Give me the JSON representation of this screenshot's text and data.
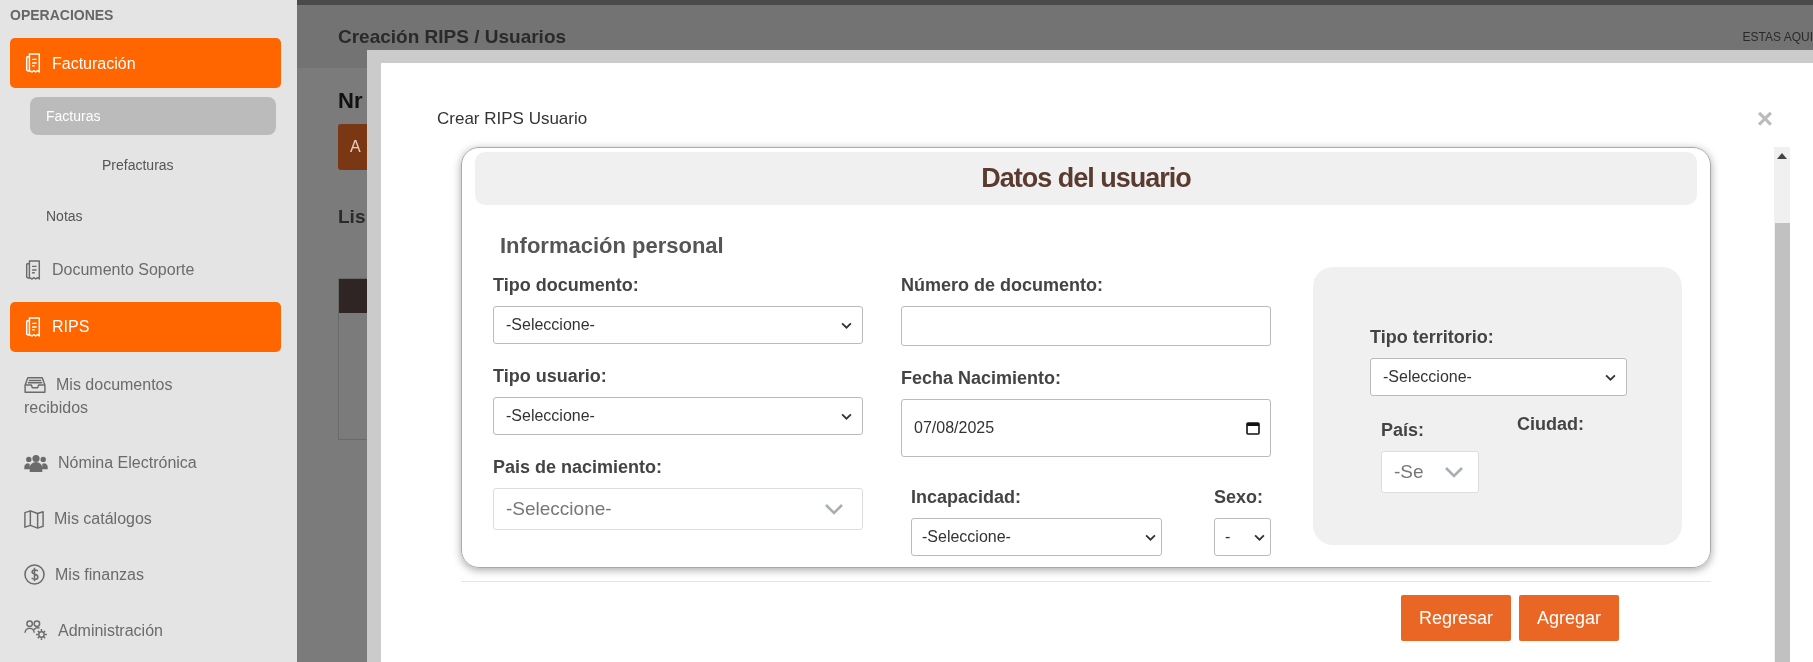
{
  "sidebar": {
    "section": "OPERACIONES",
    "items": [
      {
        "label": "Facturación",
        "selected": true,
        "children": [
          {
            "label": "Facturas",
            "selected": true,
            "children": [
              {
                "label": "Prefacturas",
                "selected": false
              }
            ]
          },
          {
            "label": "Notas",
            "selected": false
          }
        ]
      },
      {
        "label": "Documento Soporte",
        "selected": false
      },
      {
        "label": "RIPS",
        "selected": true
      },
      {
        "label": "Mis documentos recibidos",
        "selected": false
      },
      {
        "label": "Nómina Electrónica",
        "selected": false
      },
      {
        "label": "Mis catálogos",
        "selected": false
      },
      {
        "label": "Mis finanzas",
        "selected": false
      },
      {
        "label": "Administración",
        "selected": false
      }
    ]
  },
  "header": {
    "breadcrumb": "Creación RIPS / Usuarios",
    "location_label": "ESTAS AQUI"
  },
  "page": {
    "title": "Nr",
    "button": "A",
    "section_title": "Lis"
  },
  "modal": {
    "title": "Crear RIPS Usuario",
    "close": "×",
    "card_title": "Datos del usuario",
    "subtitle": "Información personal",
    "columns": [
      [
        {
          "kind": "select",
          "label": "Tipo documento:",
          "value": "-Seleccione-"
        },
        {
          "kind": "select",
          "label": "Tipo usuario:",
          "value": "-Seleccione-"
        },
        {
          "kind": "select2",
          "label": "Pais de nacimiento:",
          "value": "-Seleccione-"
        }
      ],
      [
        {
          "kind": "text",
          "label": "Número de documento:"
        },
        {
          "kind": "date",
          "label": "Fecha Nacimiento:",
          "value": "07/08/2025"
        },
        {
          "kind": "row",
          "fields": [
            {
              "kind": "select",
              "label": "Incapacidad:",
              "value": "-Seleccione-"
            },
            {
              "kind": "select",
              "label": "Sexo:",
              "value": "-"
            }
          ]
        }
      ]
    ],
    "panel": [
      {
        "kind": "select",
        "label": "Tipo territorio:",
        "value": "-Seleccione-"
      },
      {
        "kind": "row",
        "fields": [
          {
            "kind": "select2",
            "label": "País:",
            "value": "-Se"
          },
          {
            "kind": "label",
            "label": "Ciudad:"
          }
        ]
      }
    ],
    "buttons": [
      "Regresar",
      "Agregar"
    ]
  }
}
